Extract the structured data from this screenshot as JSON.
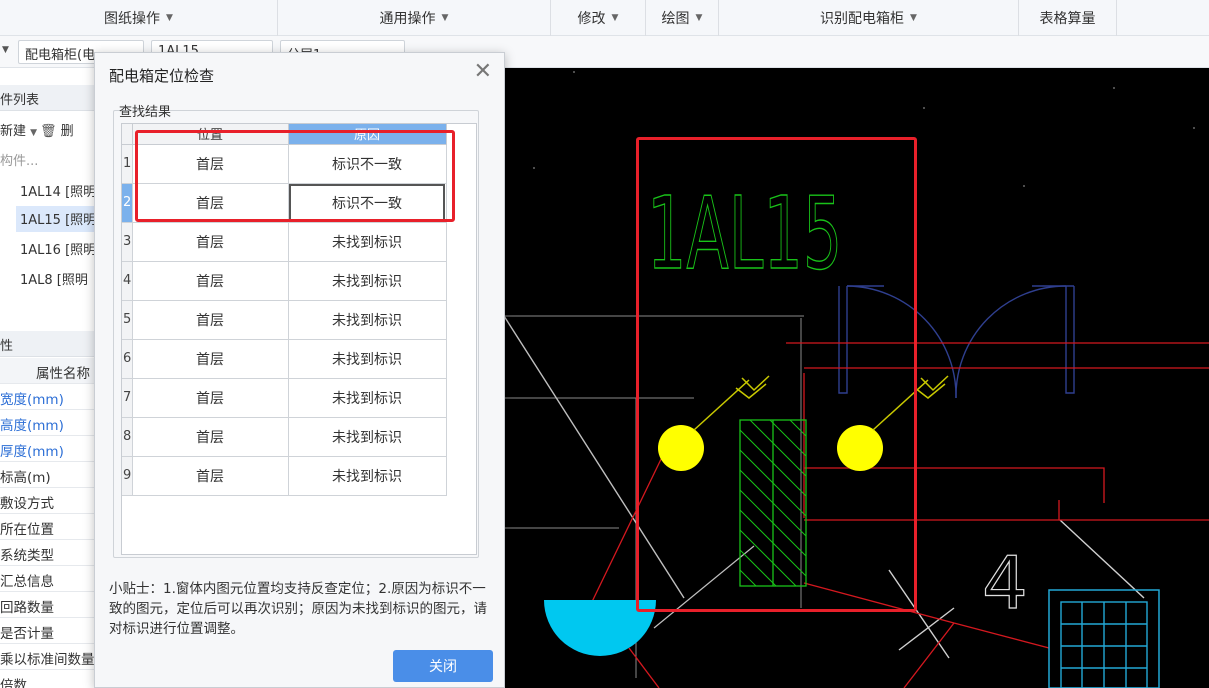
{
  "ribbon": {
    "groups": [
      "图纸操作",
      "通用操作",
      "修改",
      "绘图",
      "识别配电箱柜",
      "表格算量"
    ]
  },
  "toolbar": {
    "combo1": "配电箱柜(电",
    "combo2": "1AL15",
    "combo3": "分层1"
  },
  "left_panel": {
    "list_header": "件列表",
    "new_label": "新建",
    "delete_label": "删",
    "search_placeholder": "构件...",
    "items": [
      "1AL14 [照明",
      "1AL15 [照明",
      "1AL16 [照明",
      "1AL8 [照明"
    ],
    "selected_index": 1,
    "prop_header": "性",
    "prop_col_name": "属性名称",
    "properties": [
      "宽度(mm)",
      "高度(mm)",
      "厚度(mm)",
      "标高(m)",
      "敷设方式",
      "所在位置",
      "系统类型",
      "汇总信息",
      "回路数量",
      "是否计量",
      "乘以标准间数量",
      "倍数"
    ]
  },
  "dialog": {
    "title": "配电箱定位检查",
    "group_title": "查找结果",
    "columns": [
      "位置",
      "原因"
    ],
    "rows": [
      {
        "index": "1",
        "location": "首层",
        "reason": "标识不一致"
      },
      {
        "index": "2",
        "location": "首层",
        "reason": "标识不一致"
      },
      {
        "index": "3",
        "location": "首层",
        "reason": "未找到标识"
      },
      {
        "index": "4",
        "location": "首层",
        "reason": "未找到标识"
      },
      {
        "index": "5",
        "location": "首层",
        "reason": "未找到标识"
      },
      {
        "index": "6",
        "location": "首层",
        "reason": "未找到标识"
      },
      {
        "index": "7",
        "location": "首层",
        "reason": "未找到标识"
      },
      {
        "index": "8",
        "location": "首层",
        "reason": "未找到标识"
      },
      {
        "index": "9",
        "location": "首层",
        "reason": "未找到标识"
      }
    ],
    "tip": "小贴士：1.窗体内图元位置均支持反查定位；2.原因为标识不一致的图元，定位后可以再次识别；原因为未找到标识的图元，请对标识进行位置调整。",
    "close_button": "关闭"
  },
  "canvas": {
    "box_label": "1AL15",
    "circuit_number": "4"
  },
  "colors": {
    "highlight": "#e8202a",
    "canvas_bg": "#000000",
    "label_green": "#19c219",
    "accent_blue": "#4a8ee8"
  }
}
